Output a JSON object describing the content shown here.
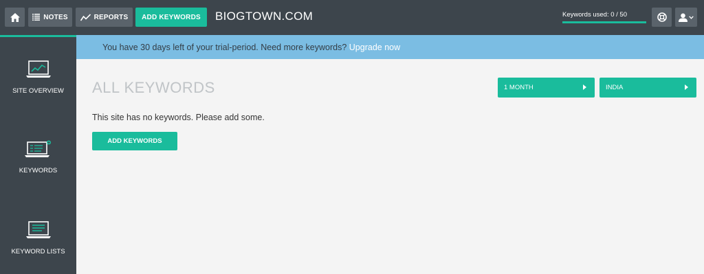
{
  "topbar": {
    "notes_label": "NOTES",
    "reports_label": "REPORTS",
    "add_keywords_label": "ADD KEYWORDS",
    "site_name": "BIOGTOWN.COM",
    "keywords_used_label": "Keywords used: 0 / 50",
    "keywords_used": 0,
    "keywords_limit": 50,
    "icons": [
      "home-icon",
      "notes-icon",
      "reports-icon",
      "help-icon",
      "user-icon",
      "chevron-down-icon"
    ]
  },
  "sidebar": {
    "items": [
      {
        "label": "SITE OVERVIEW",
        "icon": "laptop-chart-icon",
        "active": true
      },
      {
        "label": "KEYWORDS",
        "icon": "laptop-keywords-icon"
      },
      {
        "label": "KEYWORD LISTS",
        "icon": "laptop-list-icon"
      }
    ]
  },
  "banner": {
    "text": "You have 30 days left of your trial-period. Need more keywords?",
    "link": "Upgrade now"
  },
  "main": {
    "title": "ALL KEYWORDS",
    "period_label": "1 MONTH",
    "country_label": "INDIA",
    "empty_message": "This site has no keywords. Please add some.",
    "add_keywords_label": "ADD KEYWORDS"
  },
  "colors": {
    "accent": "#1abc9c",
    "topbar_bg": "#3d454c",
    "button_bg": "#5a636b",
    "banner_bg": "#7bbde3",
    "content_bg": "#f4f4f4",
    "title_color": "#c0c4c7"
  }
}
